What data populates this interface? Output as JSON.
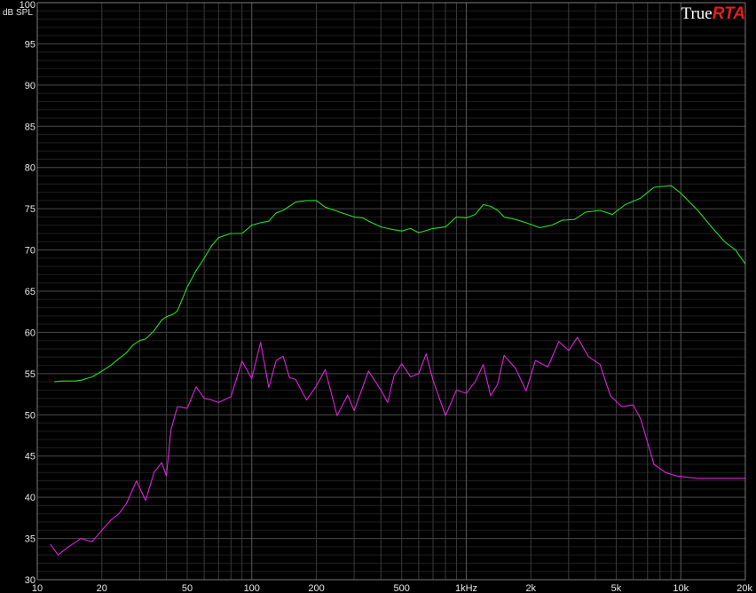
{
  "brand": {
    "part1": "True",
    "part2": "RTA"
  },
  "chart_data": {
    "type": "line",
    "ylabel": "dB SPL",
    "xscale": "log",
    "xlim": [
      10,
      20000
    ],
    "ylim": [
      30,
      100
    ],
    "grid": true,
    "yticks": [
      30,
      35,
      40,
      45,
      50,
      55,
      60,
      65,
      70,
      75,
      80,
      85,
      90,
      95,
      100
    ],
    "xticks": [
      {
        "value": 10,
        "label": "10"
      },
      {
        "value": 20,
        "label": "20"
      },
      {
        "value": 50,
        "label": "50"
      },
      {
        "value": 100,
        "label": "100"
      },
      {
        "value": 200,
        "label": "200"
      },
      {
        "value": 500,
        "label": "500"
      },
      {
        "value": 1000,
        "label": "1kHz"
      },
      {
        "value": 2000,
        "label": "2k"
      },
      {
        "value": 5000,
        "label": "5k"
      },
      {
        "value": 10000,
        "label": "10k"
      },
      {
        "value": 20000,
        "label": "20k"
      }
    ],
    "colors": {
      "background": "#000000",
      "grid": "#3a3a3a",
      "series1": "#22e022",
      "series2": "#dd22dd"
    },
    "series": [
      {
        "color": "#22e022",
        "x": [
          12,
          13,
          14,
          15,
          16,
          17,
          18,
          20,
          22,
          24,
          26,
          28,
          30,
          32,
          35,
          38,
          40,
          43,
          45,
          50,
          55,
          60,
          65,
          70,
          80,
          90,
          100,
          110,
          120,
          130,
          140,
          160,
          180,
          200,
          220,
          250,
          300,
          330,
          350,
          400,
          450,
          500,
          550,
          600,
          700,
          800,
          900,
          1000,
          1100,
          1200,
          1300,
          1400,
          1500,
          1700,
          1900,
          2200,
          2500,
          2800,
          3200,
          3600,
          4200,
          4800,
          5500,
          6500,
          7500,
          9000,
          10000,
          12000,
          14000,
          16000,
          18000,
          20000
        ],
        "y": [
          54.0,
          54.1,
          54.1,
          54.1,
          54.2,
          54.4,
          54.6,
          55.3,
          56.0,
          56.8,
          57.5,
          58.5,
          59.0,
          59.2,
          60.2,
          61.5,
          61.9,
          62.2,
          62.6,
          65.5,
          67.5,
          69.0,
          70.5,
          71.5,
          72.0,
          72.0,
          73.0,
          73.3,
          73.5,
          74.5,
          74.8,
          75.8,
          76.0,
          76.0,
          75.2,
          74.7,
          74.0,
          73.9,
          73.5,
          72.8,
          72.5,
          72.3,
          72.6,
          72.1,
          72.6,
          72.8,
          74.0,
          73.9,
          74.3,
          75.5,
          75.3,
          74.8,
          74.0,
          73.7,
          73.3,
          72.7,
          73.0,
          73.6,
          73.7,
          74.6,
          74.8,
          74.3,
          75.5,
          76.3,
          77.6,
          77.8,
          76.9,
          74.8,
          72.7,
          71.0,
          70.0,
          68.3
        ]
      },
      {
        "color": "#dd22dd",
        "x": [
          11.5,
          12.5,
          14,
          16,
          18,
          20,
          22,
          24,
          26,
          29,
          32,
          35,
          38,
          40,
          42,
          45,
          50,
          55,
          60,
          65,
          70,
          80,
          90,
          100,
          110,
          120,
          130,
          140,
          150,
          160,
          180,
          200,
          220,
          250,
          280,
          300,
          350,
          400,
          430,
          460,
          500,
          550,
          600,
          650,
          700,
          800,
          900,
          1000,
          1100,
          1200,
          1300,
          1400,
          1500,
          1700,
          1900,
          2100,
          2400,
          2700,
          3000,
          3300,
          3700,
          4200,
          4700,
          5300,
          6000,
          6500,
          7500,
          8500,
          9500,
          11000,
          12000,
          14000,
          16000,
          18000,
          20000
        ],
        "y": [
          34.3,
          33.0,
          34.0,
          35.0,
          34.6,
          36.0,
          37.2,
          38.0,
          39.2,
          42.0,
          39.6,
          43.0,
          44.2,
          42.6,
          48.2,
          51.0,
          50.8,
          53.4,
          52.0,
          51.8,
          51.5,
          52.2,
          56.5,
          54.4,
          58.8,
          53.3,
          56.6,
          57.1,
          54.5,
          54.3,
          51.8,
          53.5,
          55.5,
          49.9,
          52.4,
          50.5,
          55.3,
          53.0,
          51.5,
          54.7,
          56.2,
          54.6,
          55.0,
          57.4,
          54.2,
          49.9,
          53.0,
          52.6,
          54.0,
          56.1,
          52.3,
          53.7,
          57.2,
          55.6,
          52.9,
          56.6,
          55.8,
          58.9,
          57.8,
          59.4,
          57.1,
          56.1,
          52.3,
          51.0,
          51.2,
          49.5,
          44.0,
          43.0,
          42.6,
          42.4,
          42.3,
          42.3,
          42.3,
          42.3,
          42.3
        ]
      }
    ]
  }
}
